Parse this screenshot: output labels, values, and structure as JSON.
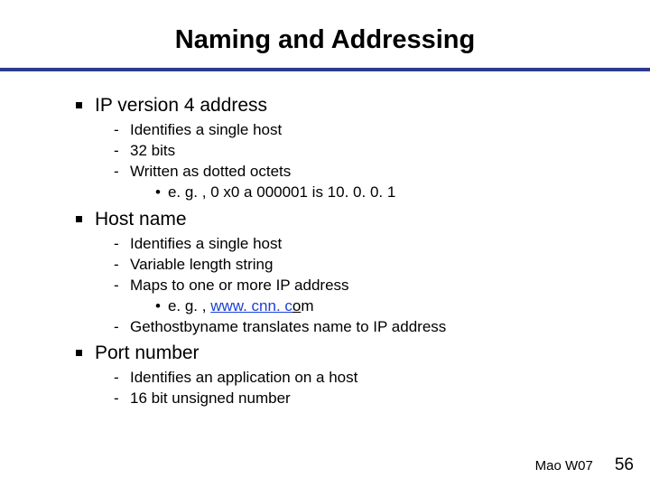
{
  "title": "Naming and Addressing",
  "sections": [
    {
      "heading": "IP version 4 address",
      "items": [
        {
          "text": "Identifies a single host"
        },
        {
          "text": "32 bits"
        },
        {
          "text": "Written as dotted octets",
          "sub": [
            {
              "text": "e. g. , 0 x0 a 000001 is 10. 0. 0. 1"
            }
          ]
        }
      ]
    },
    {
      "heading": "Host name",
      "items": [
        {
          "text": "Identifies a single host"
        },
        {
          "text": "Variable length string"
        },
        {
          "text": "Maps to one or more IP address",
          "sub": [
            {
              "prefix": "e. g. , ",
              "link": "www. cnn. c",
              "linktail": "o",
              "suffix": "m"
            }
          ]
        },
        {
          "text": "Gethostbyname translates name to IP address"
        }
      ]
    },
    {
      "heading": "Port number",
      "items": [
        {
          "text": "Identifies an application on a host"
        },
        {
          "text": "16 bit unsigned number"
        }
      ]
    }
  ],
  "footer": {
    "credit": "Mao W07",
    "page": "56"
  }
}
